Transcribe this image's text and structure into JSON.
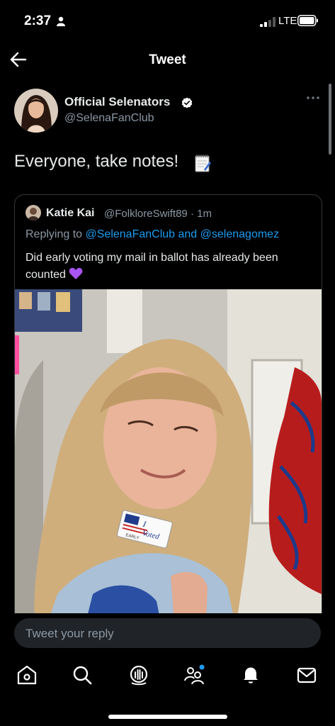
{
  "status_bar": {
    "time": "2:37",
    "network": "LTE"
  },
  "header": {
    "title": "Tweet"
  },
  "tweet": {
    "author_name": "Official Selenators",
    "author_handle": "@SelenaFanClub",
    "text": "Everyone, take notes!",
    "emoji": "memo-icon"
  },
  "quoted_tweet": {
    "author_name": "Katie Kai",
    "author_handle": "@FolkloreSwift89",
    "separator": "·",
    "time": "1m",
    "replying_prefix": "Replying to",
    "reply_user1": "@SelenaFanClub",
    "reply_and": "and",
    "reply_user2": "@selenagomez",
    "text": "Did early voting my mail in ballot has already been counted",
    "emoji": "purple-heart-icon",
    "sticker_line1": "I",
    "sticker_line2": "Voted",
    "sticker_line3": "EARLY"
  },
  "reply": {
    "placeholder": "Tweet your reply"
  },
  "tabbar": {
    "items": [
      "home-icon",
      "search-icon",
      "spaces-icon",
      "communities-icon",
      "notifications-icon",
      "messages-icon"
    ]
  },
  "colors": {
    "background": "#000000",
    "accent": "#1d9bf0",
    "verified": "#ffffff",
    "secondary_text": "#8b98a5"
  }
}
